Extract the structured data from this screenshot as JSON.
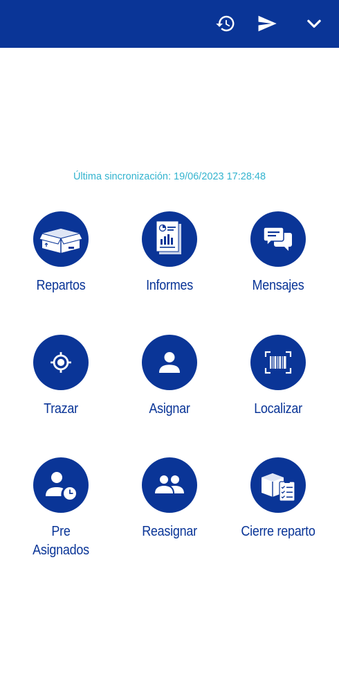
{
  "header": {
    "history_icon": "history-icon",
    "send_icon": "send-icon",
    "chevron_icon": "chevron-down-icon"
  },
  "sync_text": "Última sincronización: 19/06/2023 17:28:48",
  "menu": [
    {
      "label": "Repartos",
      "icon": "box-icon"
    },
    {
      "label": "Informes",
      "icon": "report-icon"
    },
    {
      "label": "Mensajes",
      "icon": "messages-icon"
    },
    {
      "label": "Trazar",
      "icon": "gps-target-icon"
    },
    {
      "label": "Asignar",
      "icon": "person-icon"
    },
    {
      "label": "Localizar",
      "icon": "barcode-icon"
    },
    {
      "label": "Pre\nAsignados",
      "icon": "person-clock-icon"
    },
    {
      "label": "Reasignar",
      "icon": "group-icon"
    },
    {
      "label": "Cierre reparto",
      "icon": "box-checklist-icon"
    }
  ],
  "colors": {
    "primary": "#0a3597",
    "sync_text": "#34b4cf",
    "background": "#ffffff"
  }
}
